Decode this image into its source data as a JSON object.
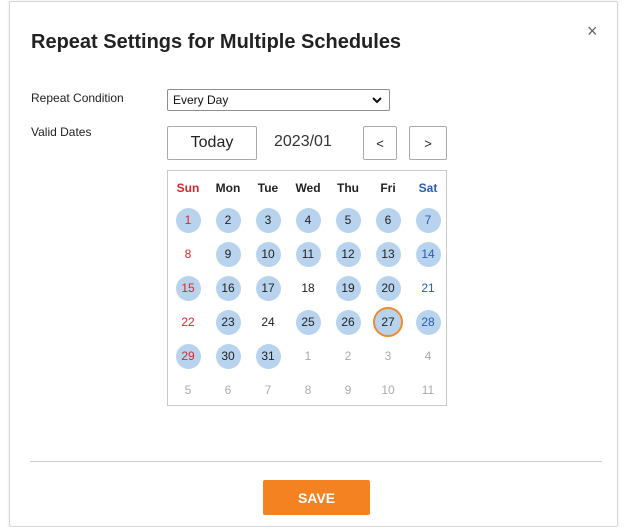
{
  "dialog": {
    "title": "Repeat Settings for Multiple Schedules",
    "close_symbol": "×"
  },
  "repeat_condition": {
    "label": "Repeat Condition",
    "value": "Every Day"
  },
  "valid_dates": {
    "label": "Valid Dates",
    "today_button": "Today",
    "month": "2023/01",
    "prev_button": "<",
    "next_button": ">"
  },
  "calendar": {
    "weekdays": [
      "Sun",
      "Mon",
      "Tue",
      "Wed",
      "Thu",
      "Fri",
      "Sat"
    ],
    "weeks": [
      [
        {
          "d": "1",
          "s": "sel"
        },
        {
          "d": "2",
          "s": "sel"
        },
        {
          "d": "3",
          "s": "sel"
        },
        {
          "d": "4",
          "s": "sel"
        },
        {
          "d": "5",
          "s": "sel"
        },
        {
          "d": "6",
          "s": "sel"
        },
        {
          "d": "7",
          "s": "sel"
        }
      ],
      [
        {
          "d": "8",
          "s": ""
        },
        {
          "d": "9",
          "s": "sel"
        },
        {
          "d": "10",
          "s": "sel"
        },
        {
          "d": "11",
          "s": "sel"
        },
        {
          "d": "12",
          "s": "sel"
        },
        {
          "d": "13",
          "s": "sel"
        },
        {
          "d": "14",
          "s": "sel"
        }
      ],
      [
        {
          "d": "15",
          "s": "sel"
        },
        {
          "d": "16",
          "s": "sel"
        },
        {
          "d": "17",
          "s": "sel"
        },
        {
          "d": "18",
          "s": ""
        },
        {
          "d": "19",
          "s": "sel"
        },
        {
          "d": "20",
          "s": "sel"
        },
        {
          "d": "21",
          "s": ""
        }
      ],
      [
        {
          "d": "22",
          "s": ""
        },
        {
          "d": "23",
          "s": "sel"
        },
        {
          "d": "24",
          "s": ""
        },
        {
          "d": "25",
          "s": "sel"
        },
        {
          "d": "26",
          "s": "sel"
        },
        {
          "d": "27",
          "s": "today"
        },
        {
          "d": "28",
          "s": "sel"
        }
      ],
      [
        {
          "d": "29",
          "s": "sel"
        },
        {
          "d": "30",
          "s": "sel"
        },
        {
          "d": "31",
          "s": "sel"
        },
        {
          "d": "1",
          "s": "other"
        },
        {
          "d": "2",
          "s": "other"
        },
        {
          "d": "3",
          "s": "other"
        },
        {
          "d": "4",
          "s": "other"
        }
      ],
      [
        {
          "d": "5",
          "s": "other"
        },
        {
          "d": "6",
          "s": "other"
        },
        {
          "d": "7",
          "s": "other"
        },
        {
          "d": "8",
          "s": "other"
        },
        {
          "d": "9",
          "s": "other"
        },
        {
          "d": "10",
          "s": "other"
        },
        {
          "d": "11",
          "s": "other"
        }
      ]
    ]
  },
  "footer": {
    "save_label": "SAVE"
  },
  "colors": {
    "accent": "#f58220",
    "selected_day": "#b8d3ee",
    "today_ring": "#ef8a2d",
    "sunday": "#d9262b",
    "saturday": "#2a5db0"
  },
  "icons": {
    "close": "close-icon",
    "dropdown": "chevron-down-icon"
  }
}
